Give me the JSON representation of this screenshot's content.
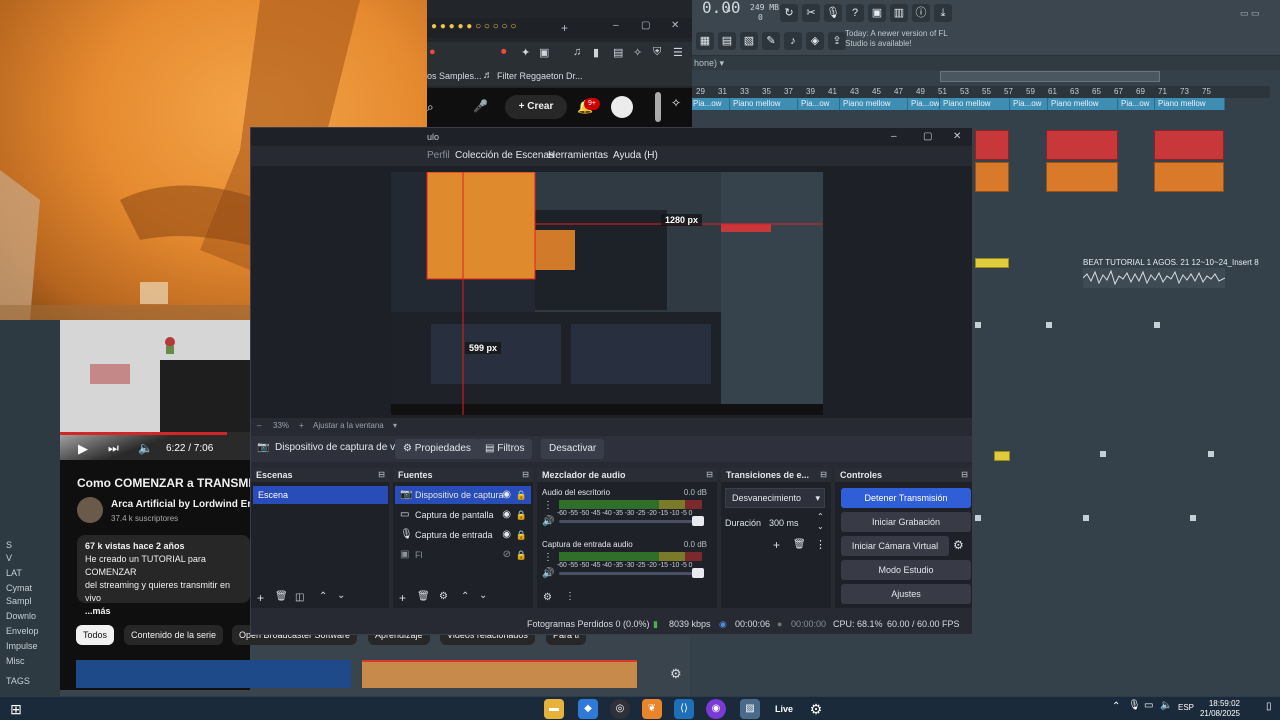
{
  "fl": {
    "top_value": "0.00",
    "small_num": "4",
    "memory": "249 MB",
    "memory_sub": "0",
    "news": "Today: A newer version of FL Studio is available!",
    "playlist_title": "hone) ▾",
    "ruler": [
      "29",
      "31",
      "33",
      "35",
      "37",
      "39",
      "41",
      "43",
      "45",
      "47",
      "49",
      "51",
      "53",
      "55",
      "57",
      "59",
      "61",
      "63",
      "65",
      "67",
      "69",
      "71",
      "73",
      "75"
    ],
    "clips": [
      {
        "label": "Pia...ow"
      },
      {
        "label": "Piano mellow"
      },
      {
        "label": "Pia...ow"
      },
      {
        "label": "Piano mellow"
      },
      {
        "label": "Pia...ow"
      },
      {
        "label": "Piano mellow"
      },
      {
        "label": "Pia...ow"
      },
      {
        "label": "Piano mellow"
      },
      {
        "label": "Pia...ow"
      },
      {
        "label": "Piano mellow"
      }
    ],
    "audio_clip": "BEAT TUTORIAL 1 AGOS. 21 12~10~24_Insert 8",
    "browser_items": [
      "S",
      "V",
      "LAT",
      "Cymat",
      "Sampl",
      "Downlo",
      "Envelop",
      "Impulse",
      "Misc",
      "TAGS"
    ]
  },
  "browser": {
    "bookmark_1": "os Samples...",
    "bookmark_2": "Filter Reggaeton Dr...",
    "crear": "Crear",
    "notifications": "9+"
  },
  "youtube": {
    "time": "6:22 / 7:06",
    "progress": 0.88,
    "title": "Como COMENZAR a TRANSMITIR",
    "channel": "Arca Artificial by Lordwind Er",
    "subscribers": "37.4 k suscriptores",
    "views_line": "67 k vistas  hace 2 años",
    "desc_1": "He creado un TUTORIAL para COMENZAR",
    "desc_2": "del streaming y quieres transmitir en vivo",
    "more": "...más",
    "chips": [
      "Todos",
      "Contenido de la serie",
      "Open Broadcaster Software",
      "Aprendizaje",
      "Videos relacionados",
      "Para ti"
    ]
  },
  "obs": {
    "title": "ulo",
    "menu": [
      "Perfil",
      "Colección de Escenas",
      "Herramientas",
      "Ayuda (H)"
    ],
    "px_w": "1280 px",
    "px_h": "599 px",
    "zoom": "33%",
    "fit": "Ajustar a la ventana",
    "src_toolbar": {
      "device": "Dispositivo de captura de v",
      "properties": "Propiedades",
      "filters": "Filtros",
      "deactivate": "Desactivar"
    },
    "scenes": {
      "header": "Escenas",
      "items": [
        "Escena"
      ]
    },
    "sources": {
      "header": "Fuentes",
      "items": [
        "Dispositivo de captura",
        "Captura de pantalla",
        "Captura de entrada",
        "Fl"
      ]
    },
    "mixer": {
      "header": "Mezclador de audio",
      "channels": [
        {
          "name": "Audio del escritorio",
          "db": "0.0 dB"
        },
        {
          "name": "Captura de entrada audio",
          "db": "0.0 dB"
        }
      ],
      "scale": "-60 -55 -50 -45 -40 -35 -30 -25 -20 -15 -10 -5 0"
    },
    "transitions": {
      "header": "Transiciones de e...",
      "type": "Desvanecimiento",
      "duration_label": "Duración",
      "duration": "300 ms"
    },
    "controls": {
      "header": "Controles",
      "stop_stream": "Detener Transmisión",
      "start_rec": "Iniciar Grabación",
      "virtual_cam": "Iniciar Cámara Virtual",
      "studio": "Modo Estudio",
      "settings": "Ajustes"
    },
    "status": {
      "dropped": "Fotogramas Perdidos 0 (0.0%)",
      "bitrate": "8039 kbps",
      "stream_time": "00:00:06",
      "rec_time": "00:00:00",
      "cpu": "CPU: 68.1%",
      "fps": "60.00 / 60.00 FPS"
    }
  },
  "taskbar": {
    "lang": "ESP",
    "time": "18:59:02",
    "date": "21/08/2025",
    "live_label": "Live"
  },
  "colors": {
    "obs_accent": "#2f5ed6",
    "yt_red": "#d1272b",
    "fl_pattern_red": "#c8383a",
    "fl_pattern_orange": "#d87a2a",
    "fl_clip_blue": "#3e8db3"
  }
}
